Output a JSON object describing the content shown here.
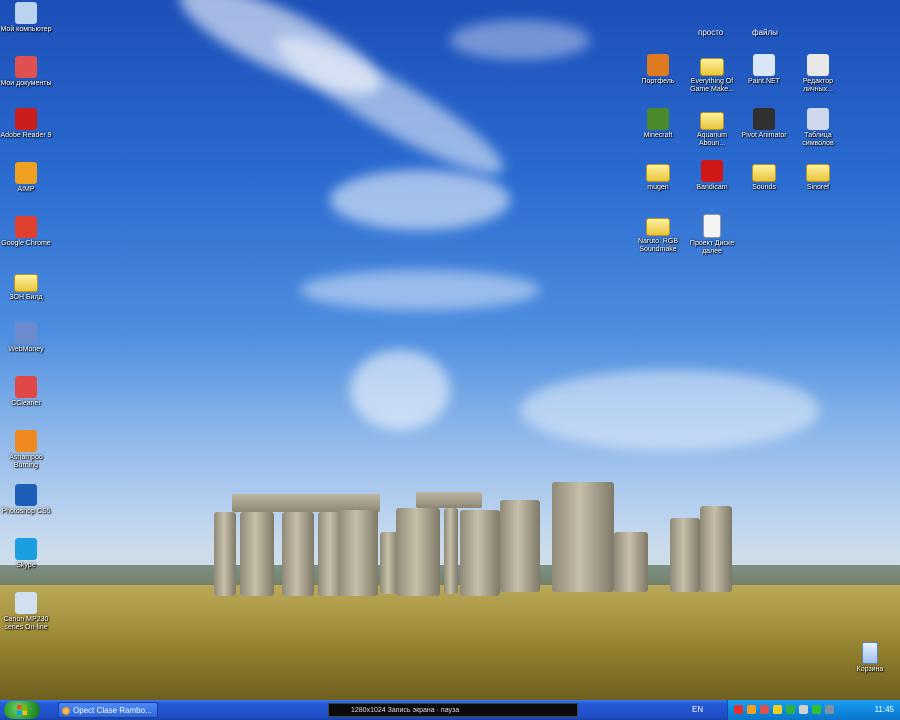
{
  "desktop_icons_left": [
    {
      "label": "Мой компьютер",
      "icon": "my-computer-icon",
      "color": "#bcd3f0"
    },
    {
      "label": "Мои документы",
      "icon": "my-documents-icon",
      "color": "#e05050"
    },
    {
      "label": "Adobe Reader 9",
      "icon": "adobe-reader-icon",
      "color": "#c81e1e"
    },
    {
      "label": "AIMP",
      "icon": "aimp-icon",
      "color": "#f0a020"
    },
    {
      "label": "Google Chrome",
      "icon": "chrome-icon",
      "color": "#e04030"
    },
    {
      "label": "ЗОН Билд",
      "icon": "folder-icon",
      "color": "#f3d45a"
    },
    {
      "label": "WebMoney",
      "icon": "webmoney-icon",
      "color": "#6a8ccf"
    },
    {
      "label": "CCleaner",
      "icon": "ccleaner-icon",
      "color": "#e04848"
    },
    {
      "label": "Ashampoo Burning",
      "icon": "burning-icon",
      "color": "#f08a20"
    },
    {
      "label": "Photoshop CS5",
      "icon": "photoshop-icon",
      "color": "#1d5fb8"
    },
    {
      "label": "Skype",
      "icon": "skype-icon",
      "color": "#1aa0e0"
    },
    {
      "label": "Canon MP230 series On-line",
      "icon": "printer-icon",
      "color": "#d0e0f0"
    }
  ],
  "desktop_icons_right_headers": [
    "просто",
    "файлы"
  ],
  "desktop_icons_right": [
    {
      "label": "Портфель",
      "icon": "briefcase-icon",
      "color": "#e07a20"
    },
    {
      "label": "Everything Of Game Make...",
      "icon": "folder-icon",
      "color": "#f3d45a"
    },
    {
      "label": "Paint.NET",
      "icon": "paintnet-icon",
      "color": "#d8e6f8"
    },
    {
      "label": "Редактор личных...",
      "icon": "editor-icon",
      "color": "#e8e8e8"
    },
    {
      "label": "Minecraft",
      "icon": "minecraft-icon",
      "color": "#4a8a2a"
    },
    {
      "label": "Aquarium Aboun...",
      "icon": "folder-icon",
      "color": "#f3d45a"
    },
    {
      "label": "Pivot Animator",
      "icon": "pivot-icon",
      "color": "#303030"
    },
    {
      "label": "Таблица символов",
      "icon": "charmap-icon",
      "color": "#d0d8f0"
    },
    {
      "label": "mugen",
      "icon": "folder-icon",
      "color": "#f3d45a"
    },
    {
      "label": "Bandicam",
      "icon": "bandicam-icon",
      "color": "#d01818"
    },
    {
      "label": "Sounds",
      "icon": "folder-icon",
      "color": "#f3d45a"
    },
    {
      "label": "Sinoref",
      "icon": "folder-icon",
      "color": "#f3d45a"
    },
    {
      "label": "Naruto. RGB Soundmake",
      "icon": "folder-icon",
      "color": "#f3d45a"
    },
    {
      "label": "Проект Диске далее",
      "icon": "file-icon",
      "color": "#f5f5f5"
    }
  ],
  "recycle_bin": {
    "label": "Корзина",
    "icon": "recycle-bin-icon"
  },
  "taskbar": {
    "start_icon": "windows-logo-icon",
    "task_button": "Opect Clase Rambo...",
    "media_text": "1280x1024 Запись экрана · пауза",
    "language": "EN",
    "clock": "11:45",
    "tray_icons": [
      "#e03030",
      "#f0a020",
      "#e05050",
      "#f0d020",
      "#30b040",
      "#d0d0d0",
      "#30c030",
      "#8090a0"
    ]
  }
}
